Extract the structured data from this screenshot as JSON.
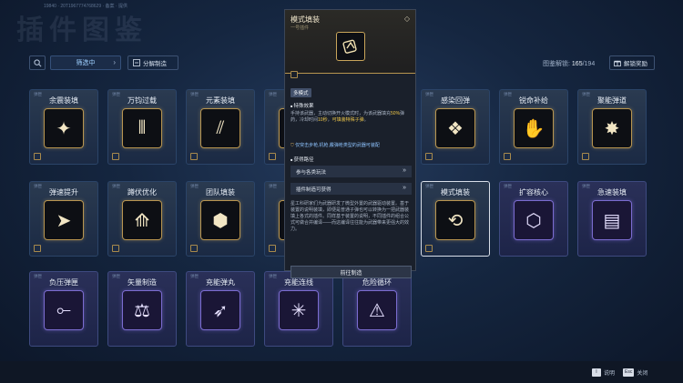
{
  "page": {
    "bg_title": "插件图鉴",
    "uid": "19840 · 20T1967774768629 · 备案 · 提供"
  },
  "toolbar": {
    "filter_label": "筛选中",
    "decompose_label": "分解制造",
    "progress_label": "图鉴解锁:",
    "progress_value": "165",
    "progress_total": "/194",
    "reward_label": "解锁奖励"
  },
  "cards": [
    {
      "tag": "弹匣",
      "name": "余震装填",
      "style": "gold"
    },
    {
      "tag": "弹匣",
      "name": "万钧过载",
      "style": "gold"
    },
    {
      "tag": "弹匣",
      "name": "元素装填",
      "style": "gold"
    },
    {
      "tag": "弹匣",
      "name": "",
      "style": "gold"
    },
    {
      "tag": "弹匣",
      "name": "感染回弹",
      "style": "gold"
    },
    {
      "tag": "弹匣",
      "name": "锐命补给",
      "style": "gold"
    },
    {
      "tag": "弹匣",
      "name": "聚能弹道",
      "style": "gold"
    },
    {
      "tag": "弹匣",
      "name": "弹速提升",
      "style": "gold"
    },
    {
      "tag": "弹匣",
      "name": "蹲伏优化",
      "style": "gold"
    },
    {
      "tag": "弹匣",
      "name": "团队填装",
      "style": "gold"
    },
    {
      "tag": "弹匣",
      "name": "",
      "style": "gold"
    },
    {
      "tag": "弹匣",
      "name": "模式填装",
      "style": "gold"
    },
    {
      "tag": "弹匣",
      "name": "扩容核心",
      "style": "purple"
    },
    {
      "tag": "弹匣",
      "name": "急速装填",
      "style": "purple"
    },
    {
      "tag": "弹匣",
      "name": "负压弹匣",
      "style": "purple"
    },
    {
      "tag": "弹匣",
      "name": "矢量制造",
      "style": "purple"
    },
    {
      "tag": "弹匣",
      "name": "充能弹丸",
      "style": "purple"
    },
    {
      "tag": "弹匣",
      "name": "充能连线",
      "style": "purple"
    },
    {
      "tag": "弹匣",
      "name": "危险循环",
      "style": "purple"
    }
  ],
  "popup": {
    "title": "模式填装",
    "subtitle": "一号插件",
    "mode": "多模式",
    "effect_header": "特殊效果",
    "effect_text_1": "手持该武器，主动切换开火模式时，为该武器填充",
    "effect_highlight_1": "50%",
    "effect_text_2": "弹药，冷却时间",
    "effect_highlight_2": "10秒",
    "effect_text_3": "，",
    "effect_highlight_3": "可填装特殊子弹",
    "effect_text_4": "。",
    "restriction": "仅突击步枪,机枪,霰弹枪类型的武器可装配",
    "source_header": "获得路径",
    "source_1": "参与各类玩法",
    "source_2": "插件制造可获得",
    "lore": "星工科研家们为武器研发了微型外置的武器驱动装置。基于装置的说明装填，即便是普通子弹也可以转换为一把武器装填上各式的插件。同样基于装置的说明，不同插件的组合公式可做合并编译——而这编译往往能为武器带来更强大的效力。",
    "goto_label": "前往制造"
  },
  "footer": {
    "help_key": "I",
    "help_label": "说明",
    "close_key": "Esc",
    "close_label": "关闭"
  }
}
